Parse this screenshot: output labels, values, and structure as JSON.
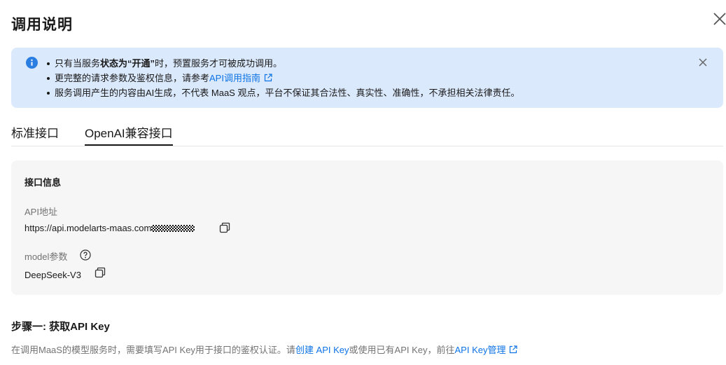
{
  "dialog": {
    "title": "调用说明"
  },
  "alert": {
    "line1": {
      "pre": "只有当服务",
      "bold": "状态为“开通”",
      "post": "时，预置服务才可被成功调用。"
    },
    "line2": {
      "pre": "更完整的请求参数及鉴权信息，请参考",
      "link": "API调用指南"
    },
    "line3": "服务调用产生的内容由AI生成，不代表 MaaS 观点，平台不保证其合法性、真实性、准确性，不承担相关法律责任。"
  },
  "tabs": [
    {
      "label": "标准接口",
      "active": false
    },
    {
      "label": "OpenAI兼容接口",
      "active": true
    }
  ],
  "interface_info": {
    "title": "接口信息",
    "api_address_label": "API地址",
    "api_address_value": "https://api.modelarts-maas.com",
    "model_param_label": "model参数",
    "model_param_value": "DeepSeek-V3"
  },
  "step1": {
    "title": "步骤一: 获取API Key",
    "desc_pre": "在调用MaaS的模型服务时，需要填写API Key用于接口的鉴权认证。请",
    "link_create": "创建 API Key",
    "desc_mid": "或使用已有API Key，前往",
    "link_manage": "API Key管理"
  },
  "colors": {
    "accent": "#0d73e6",
    "alert_bg": "#dbe9fc",
    "card_bg": "#f6f6f6"
  }
}
